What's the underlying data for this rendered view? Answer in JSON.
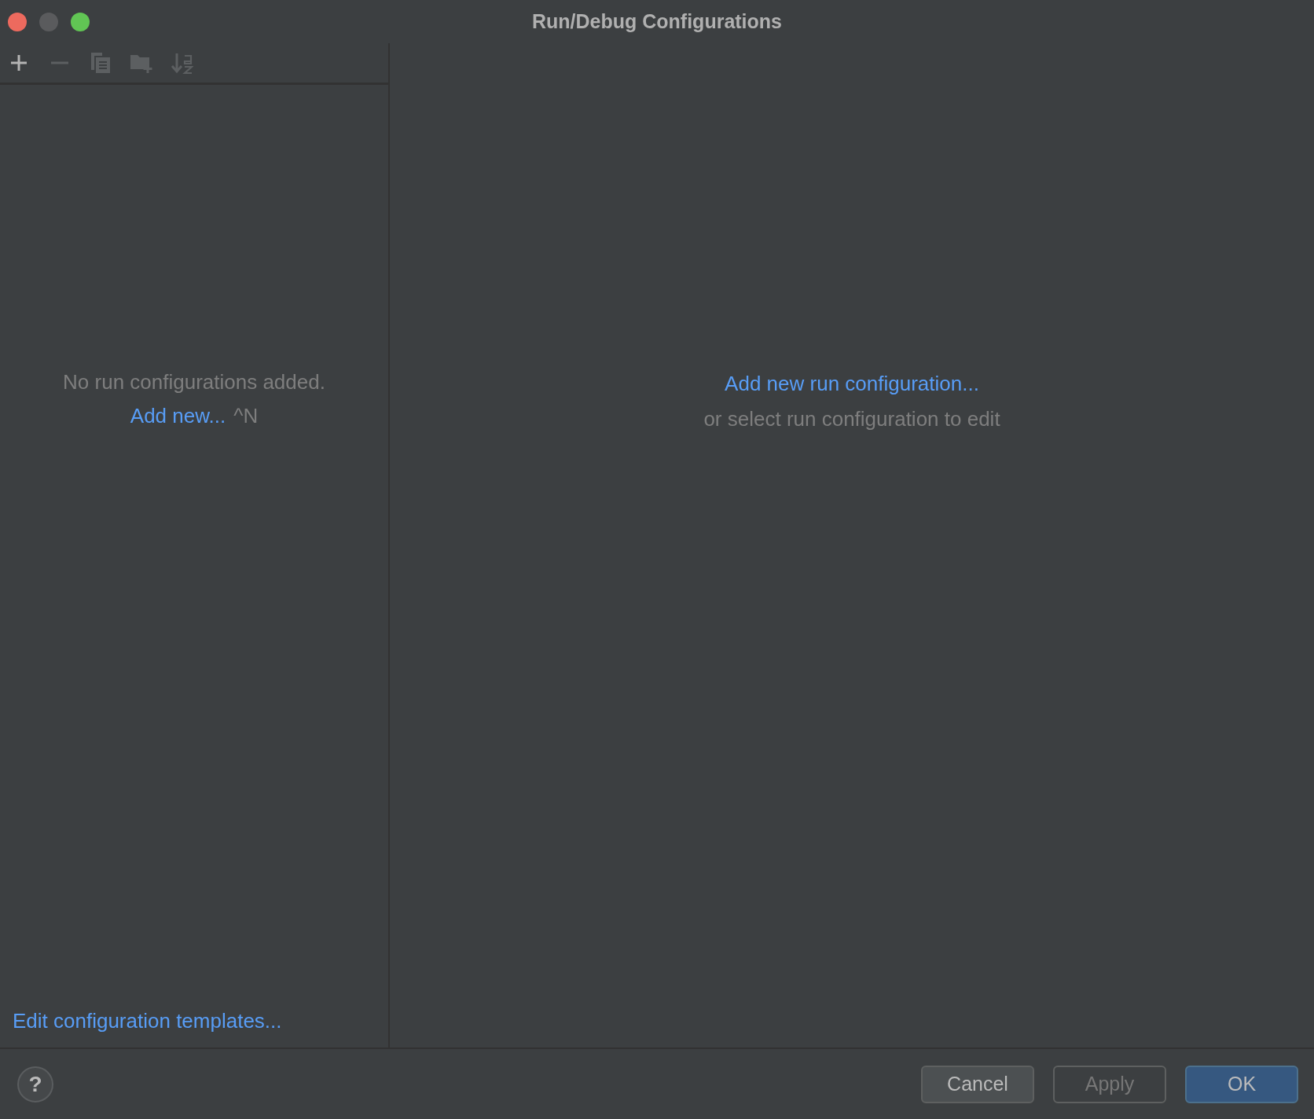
{
  "window": {
    "title": "Run/Debug Configurations",
    "controls": [
      {
        "kind": "close",
        "disabled": false
      },
      {
        "kind": "minimize",
        "disabled": true
      },
      {
        "kind": "zoom",
        "disabled": false
      }
    ]
  },
  "toolbar": [
    {
      "kind": "add",
      "disabled": false
    },
    {
      "kind": "remove",
      "disabled": true
    },
    {
      "kind": "copy",
      "disabled": true
    },
    {
      "kind": "folder",
      "disabled": true
    },
    {
      "kind": "sort",
      "disabled": true
    }
  ],
  "sidebar": {
    "empty_text": "No run configurations added.",
    "add_link": "Add new...",
    "add_shortcut": "^N",
    "templates_link": "Edit configuration templates..."
  },
  "main": {
    "add_link": "Add new run configuration...",
    "hint": "or select run configuration to edit"
  },
  "footer": {
    "help": "?",
    "buttons": [
      {
        "label": "Cancel",
        "kind": "normal",
        "disabled": false
      },
      {
        "label": "Apply",
        "kind": "normal",
        "disabled": true
      },
      {
        "label": "OK",
        "kind": "default",
        "disabled": false
      }
    ]
  }
}
